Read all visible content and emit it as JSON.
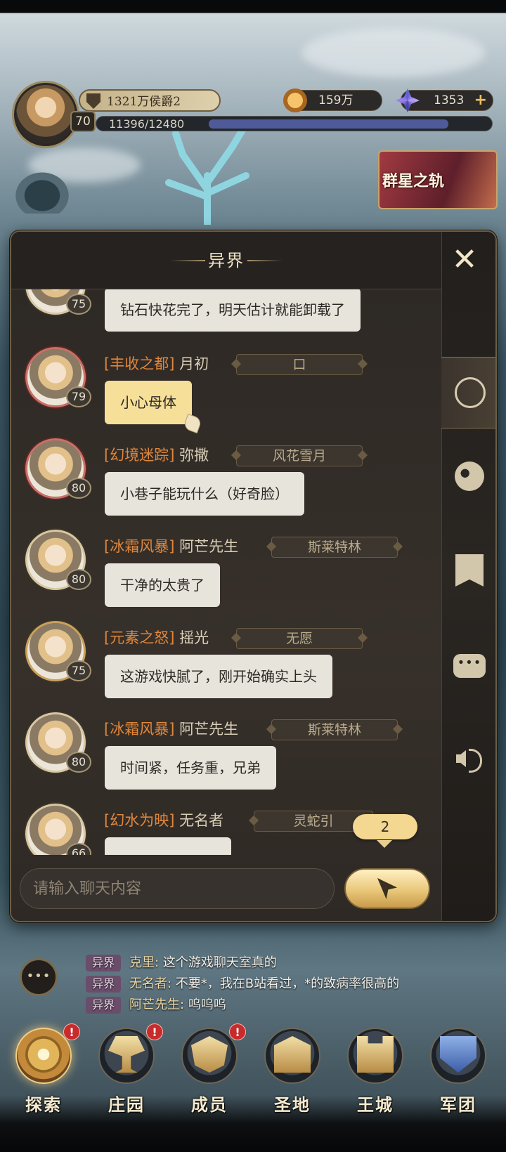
{
  "hud": {
    "title_rank": "1321万侯爵2",
    "level": "70",
    "exp_text": "11396/12480",
    "exp_progress": 0.913,
    "gold": "159万",
    "gems": "1353",
    "gem_plus": "+",
    "event_banner": "群星之轨"
  },
  "panel": {
    "title": "异界",
    "close_glyph": "✕",
    "tabs": [
      {
        "icon": "world-chat-icon",
        "active": true
      },
      {
        "icon": "globe-icon"
      },
      {
        "icon": "guild-banner-icon"
      },
      {
        "icon": "private-message-icon"
      },
      {
        "icon": "speaker-icon"
      }
    ]
  },
  "messages": [
    {
      "level": "75",
      "guild": "",
      "name": "",
      "tag": "",
      "text": "钻石快花完了，明天估计就能卸载了"
    },
    {
      "level": "79",
      "guild": "[丰收之都]",
      "name": "月初",
      "tag": "口",
      "text": "小心母体",
      "highlight": true
    },
    {
      "level": "80",
      "guild": "[幻境迷踪]",
      "name": "弥撒",
      "tag": "风花雪月",
      "text": "小巷子能玩什么（好奇脸）"
    },
    {
      "level": "80",
      "guild": "[冰霜风暴]",
      "name": "阿芒先生",
      "tag": "斯莱特林",
      "text": "干净的太贵了"
    },
    {
      "level": "75",
      "guild": "[元素之怒]",
      "name": "摇光",
      "tag": "无愿",
      "text": "这游戏快腻了，刚开始确实上头"
    },
    {
      "level": "80",
      "guild": "[冰霜风暴]",
      "name": "阿芒先生",
      "tag": "斯莱特林",
      "text": "时间紧，任务重，兄弟"
    },
    {
      "level": "66",
      "guild": "[幻水为映]",
      "name": "无名者",
      "tag": "灵蛇引",
      "text": ""
    }
  ],
  "new_message_count": "2",
  "input": {
    "placeholder": "请输入聊天内容",
    "value": ""
  },
  "ticker": {
    "more_glyph": "•••",
    "rows": [
      {
        "channel": "异界",
        "sender": "克里:",
        "text": " 这个游戏聊天室真的"
      },
      {
        "channel": "异界",
        "sender": "无名者:",
        "text": " 不要*，我在B站看过，*的致病率很高的"
      },
      {
        "channel": "异界",
        "sender": "阿芒先生:",
        "text": " 呜呜呜"
      }
    ]
  },
  "nav": [
    {
      "label": "探索",
      "alert": "!",
      "active": true
    },
    {
      "label": "庄园",
      "alert": "!"
    },
    {
      "label": "成员",
      "alert": "!"
    },
    {
      "label": "圣地",
      "alert": ""
    },
    {
      "label": "王城",
      "alert": ""
    },
    {
      "label": "军团",
      "alert": ""
    }
  ]
}
